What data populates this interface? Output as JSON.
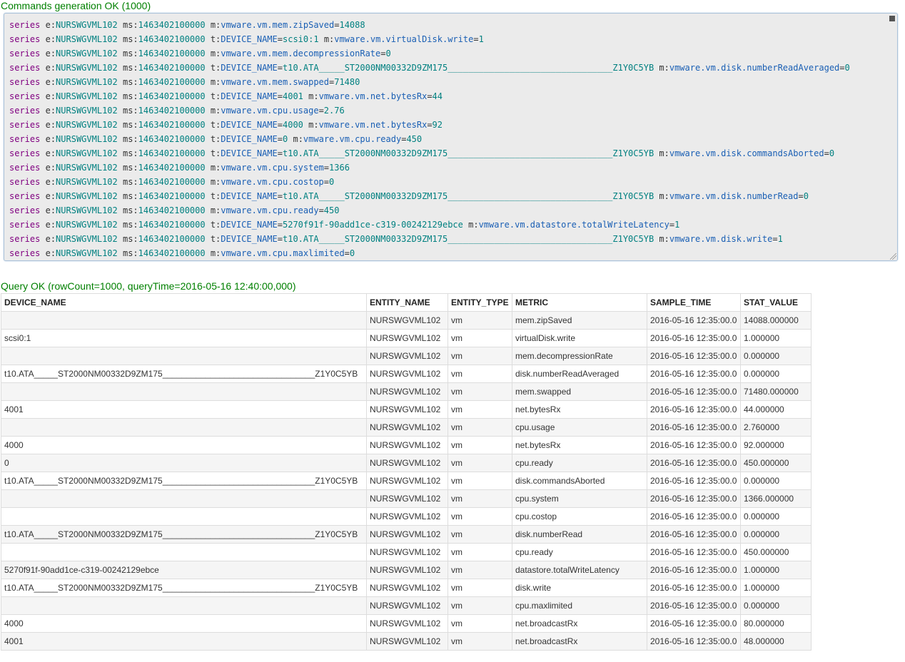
{
  "commands_status": "Commands generation OK (1000)",
  "query_status": "Query OK (rowCount=1000, queryTime=2016-05-16 12:40:00,000)",
  "commands": [
    {
      "e": "NURSWGVML102",
      "ms": "1463402100000",
      "t": "",
      "m": "vmware.vm.mem.zipSaved",
      "val": "14088"
    },
    {
      "e": "NURSWGVML102",
      "ms": "1463402100000",
      "t": "scsi0:1",
      "m": "vmware.vm.virtualDisk.write",
      "val": "1"
    },
    {
      "e": "NURSWGVML102",
      "ms": "1463402100000",
      "t": "",
      "m": "vmware.vm.mem.decompressionRate",
      "val": "0"
    },
    {
      "e": "NURSWGVML102",
      "ms": "1463402100000",
      "t": "t10.ATA_____ST2000NM00332D9ZM175________________________________Z1Y0C5YB",
      "m": "vmware.vm.disk.numberReadAveraged",
      "val": "0"
    },
    {
      "e": "NURSWGVML102",
      "ms": "1463402100000",
      "t": "",
      "m": "vmware.vm.mem.swapped",
      "val": "71480"
    },
    {
      "e": "NURSWGVML102",
      "ms": "1463402100000",
      "t": "4001",
      "m": "vmware.vm.net.bytesRx",
      "val": "44"
    },
    {
      "e": "NURSWGVML102",
      "ms": "1463402100000",
      "t": "",
      "m": "vmware.vm.cpu.usage",
      "val": "2.76"
    },
    {
      "e": "NURSWGVML102",
      "ms": "1463402100000",
      "t": "4000",
      "m": "vmware.vm.net.bytesRx",
      "val": "92"
    },
    {
      "e": "NURSWGVML102",
      "ms": "1463402100000",
      "t": "0",
      "m": "vmware.vm.cpu.ready",
      "val": "450"
    },
    {
      "e": "NURSWGVML102",
      "ms": "1463402100000",
      "t": "t10.ATA_____ST2000NM00332D9ZM175________________________________Z1Y0C5YB",
      "m": "vmware.vm.disk.commandsAborted",
      "val": "0"
    },
    {
      "e": "NURSWGVML102",
      "ms": "1463402100000",
      "t": "",
      "m": "vmware.vm.cpu.system",
      "val": "1366"
    },
    {
      "e": "NURSWGVML102",
      "ms": "1463402100000",
      "t": "",
      "m": "vmware.vm.cpu.costop",
      "val": "0"
    },
    {
      "e": "NURSWGVML102",
      "ms": "1463402100000",
      "t": "t10.ATA_____ST2000NM00332D9ZM175________________________________Z1Y0C5YB",
      "m": "vmware.vm.disk.numberRead",
      "val": "0"
    },
    {
      "e": "NURSWGVML102",
      "ms": "1463402100000",
      "t": "",
      "m": "vmware.vm.cpu.ready",
      "val": "450"
    },
    {
      "e": "NURSWGVML102",
      "ms": "1463402100000",
      "t": "5270f91f-90add1ce-c319-00242129ebce",
      "m": "vmware.vm.datastore.totalWriteLatency",
      "val": "1"
    },
    {
      "e": "NURSWGVML102",
      "ms": "1463402100000",
      "t": "t10.ATA_____ST2000NM00332D9ZM175________________________________Z1Y0C5YB",
      "m": "vmware.vm.disk.write",
      "val": "1"
    },
    {
      "e": "NURSWGVML102",
      "ms": "1463402100000",
      "t": "",
      "m": "vmware.vm.cpu.maxlimited",
      "val": "0"
    }
  ],
  "table": {
    "headers": [
      "DEVICE_NAME",
      "ENTITY_NAME",
      "ENTITY_TYPE",
      "METRIC",
      "SAMPLE_TIME",
      "STAT_VALUE"
    ],
    "rows": [
      [
        "",
        "NURSWGVML102",
        "vm",
        "mem.zipSaved",
        "2016-05-16 12:35:00.0",
        "14088.000000"
      ],
      [
        "scsi0:1",
        "NURSWGVML102",
        "vm",
        "virtualDisk.write",
        "2016-05-16 12:35:00.0",
        "1.000000"
      ],
      [
        "",
        "NURSWGVML102",
        "vm",
        "mem.decompressionRate",
        "2016-05-16 12:35:00.0",
        "0.000000"
      ],
      [
        "t10.ATA_____ST2000NM00332D9ZM175________________________________Z1Y0C5YB",
        "NURSWGVML102",
        "vm",
        "disk.numberReadAveraged",
        "2016-05-16 12:35:00.0",
        "0.000000"
      ],
      [
        "",
        "NURSWGVML102",
        "vm",
        "mem.swapped",
        "2016-05-16 12:35:00.0",
        "71480.000000"
      ],
      [
        "4001",
        "NURSWGVML102",
        "vm",
        "net.bytesRx",
        "2016-05-16 12:35:00.0",
        "44.000000"
      ],
      [
        "",
        "NURSWGVML102",
        "vm",
        "cpu.usage",
        "2016-05-16 12:35:00.0",
        "2.760000"
      ],
      [
        "4000",
        "NURSWGVML102",
        "vm",
        "net.bytesRx",
        "2016-05-16 12:35:00.0",
        "92.000000"
      ],
      [
        "0",
        "NURSWGVML102",
        "vm",
        "cpu.ready",
        "2016-05-16 12:35:00.0",
        "450.000000"
      ],
      [
        "t10.ATA_____ST2000NM00332D9ZM175________________________________Z1Y0C5YB",
        "NURSWGVML102",
        "vm",
        "disk.commandsAborted",
        "2016-05-16 12:35:00.0",
        "0.000000"
      ],
      [
        "",
        "NURSWGVML102",
        "vm",
        "cpu.system",
        "2016-05-16 12:35:00.0",
        "1366.000000"
      ],
      [
        "",
        "NURSWGVML102",
        "vm",
        "cpu.costop",
        "2016-05-16 12:35:00.0",
        "0.000000"
      ],
      [
        "t10.ATA_____ST2000NM00332D9ZM175________________________________Z1Y0C5YB",
        "NURSWGVML102",
        "vm",
        "disk.numberRead",
        "2016-05-16 12:35:00.0",
        "0.000000"
      ],
      [
        "",
        "NURSWGVML102",
        "vm",
        "cpu.ready",
        "2016-05-16 12:35:00.0",
        "450.000000"
      ],
      [
        "5270f91f-90add1ce-c319-00242129ebce",
        "NURSWGVML102",
        "vm",
        "datastore.totalWriteLatency",
        "2016-05-16 12:35:00.0",
        "1.000000"
      ],
      [
        "t10.ATA_____ST2000NM00332D9ZM175________________________________Z1Y0C5YB",
        "NURSWGVML102",
        "vm",
        "disk.write",
        "2016-05-16 12:35:00.0",
        "1.000000"
      ],
      [
        "",
        "NURSWGVML102",
        "vm",
        "cpu.maxlimited",
        "2016-05-16 12:35:00.0",
        "0.000000"
      ],
      [
        "4000",
        "NURSWGVML102",
        "vm",
        "net.broadcastRx",
        "2016-05-16 12:35:00.0",
        "80.000000"
      ],
      [
        "4001",
        "NURSWGVML102",
        "vm",
        "net.broadcastRx",
        "2016-05-16 12:35:00.0",
        "48.000000"
      ]
    ]
  }
}
